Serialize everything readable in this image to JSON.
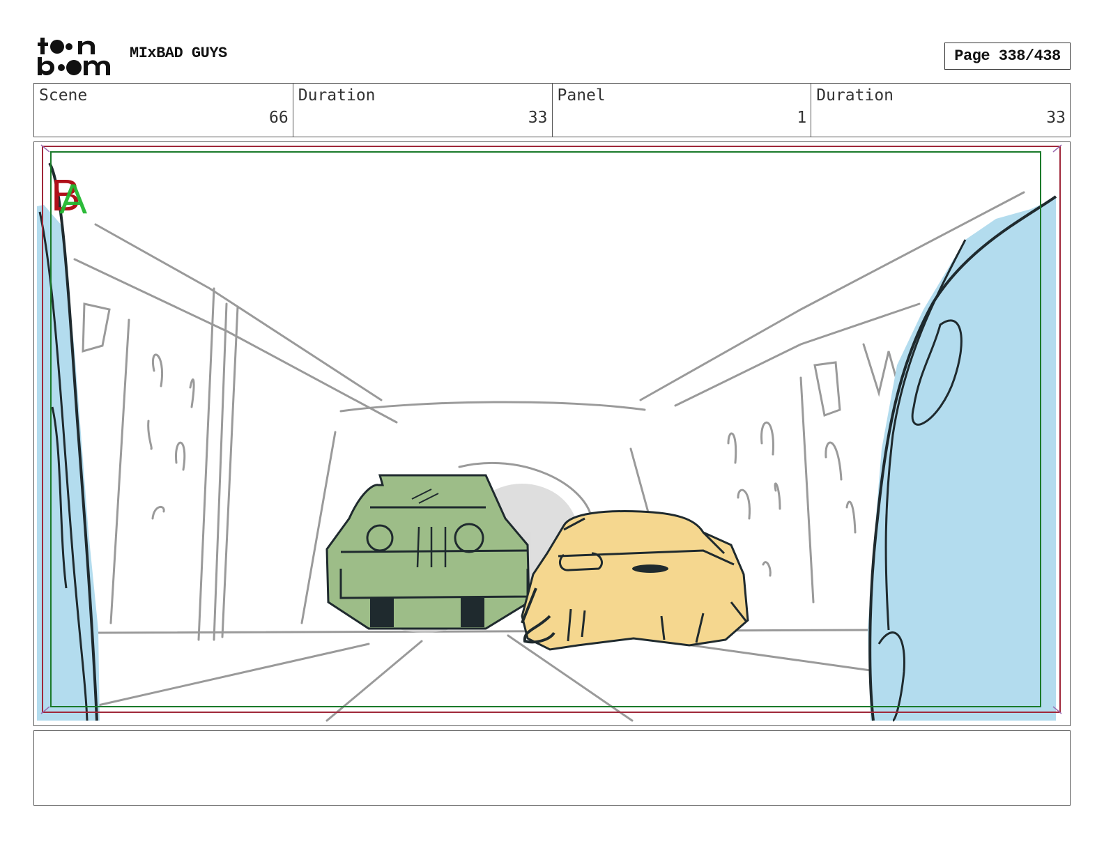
{
  "header": {
    "logo_text": "toon boom",
    "project_title": "MIxBAD GUYS",
    "page_label": "Page 338/438"
  },
  "info": {
    "scene_label": "Scene",
    "scene_value": "66",
    "scene_duration_label": "Duration",
    "scene_duration_value": "33",
    "panel_label": "Panel",
    "panel_value": "1",
    "panel_duration_label": "Duration",
    "panel_duration_value": "33"
  },
  "panel": {
    "layer_marker_back": "B",
    "layer_marker_front": "A",
    "colors": {
      "jeep": "#9dbd88",
      "sports_car": "#f5d78f",
      "foreground_walls": "#b3dcee",
      "sketch_gray": "#9a9a9a",
      "ink": "#1f2a2e",
      "safe_frame_green": "#1a7a2a",
      "safe_frame_red": "#a0283a"
    }
  },
  "notes": {
    "text": ""
  }
}
